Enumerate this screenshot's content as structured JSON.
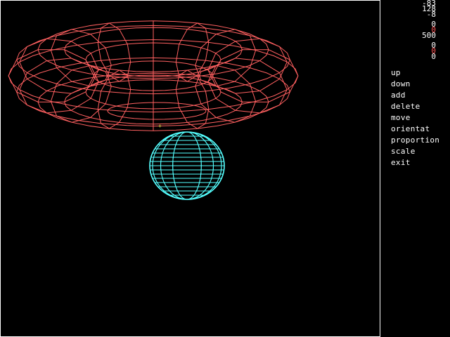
{
  "colors": {
    "background": "#000000",
    "frame": "#ffffff",
    "torus": "#ff6060",
    "sphere": "#55ffff",
    "text": "#ffffff",
    "highlight": "#ff5555",
    "cursor": "#ffff55"
  },
  "readouts": {
    "position": [
      "-83",
      "128",
      "-8"
    ],
    "group2": [
      {
        "value": "0",
        "color": "#ffffff"
      },
      {
        "value": "0",
        "color": "#ff5555"
      },
      {
        "value": "500",
        "color": "#ffffff"
      }
    ],
    "group3": [
      {
        "value": "0",
        "color": "#ffffff"
      },
      {
        "value": "0",
        "color": "#ff5555"
      },
      {
        "value": "0",
        "color": "#ffffff"
      }
    ]
  },
  "menu": {
    "items": [
      {
        "label": "up"
      },
      {
        "label": "down"
      },
      {
        "label": "add"
      },
      {
        "label": "delete"
      },
      {
        "label": "move"
      },
      {
        "label": "orientat"
      },
      {
        "label": "proportion"
      },
      {
        "label": "scale"
      },
      {
        "label": "exit"
      }
    ]
  },
  "scene": {
    "objects": [
      {
        "name": "torus",
        "shape": "torus",
        "color": "#ff6060"
      },
      {
        "name": "sphere",
        "shape": "sphere",
        "color": "#55ffff"
      }
    ],
    "cursor_glyph": "+"
  }
}
